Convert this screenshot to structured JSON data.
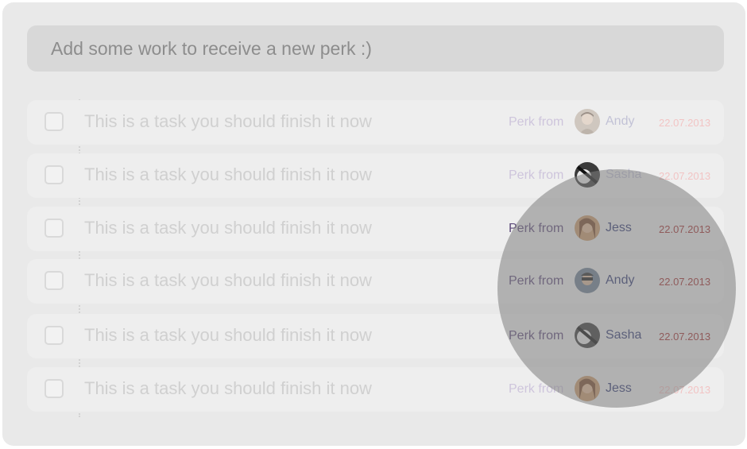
{
  "add_bar": {
    "placeholder": "Add some work to receive a new perk :)"
  },
  "tasks": [
    {
      "text": "This is a task you should finish it now",
      "perk_label": "Perk from",
      "person": "Andy",
      "date": "22.07.2013"
    },
    {
      "text": "This is a task you should finish it now",
      "perk_label": "Perk from",
      "person": "Sasha",
      "date": "22.07.2013"
    },
    {
      "text": "This is a task you should finish it now",
      "perk_label": "Perk from",
      "person": "Jess",
      "date": "22.07.2013"
    },
    {
      "text": "This is a task you should finish it now",
      "perk_label": "Perk from",
      "person": "Andy",
      "date": "22.07.2013"
    },
    {
      "text": "This is a task you should finish it now",
      "perk_label": "Perk from",
      "person": "Sasha",
      "date": "22.07.2013"
    },
    {
      "text": "This is a task you should finish it now",
      "perk_label": "Perk from",
      "person": "Jess",
      "date": "22.07.2013"
    }
  ],
  "colors": {
    "perk_label": "#5d4a7a",
    "person": "#323b74",
    "date": "#a22f2f"
  }
}
